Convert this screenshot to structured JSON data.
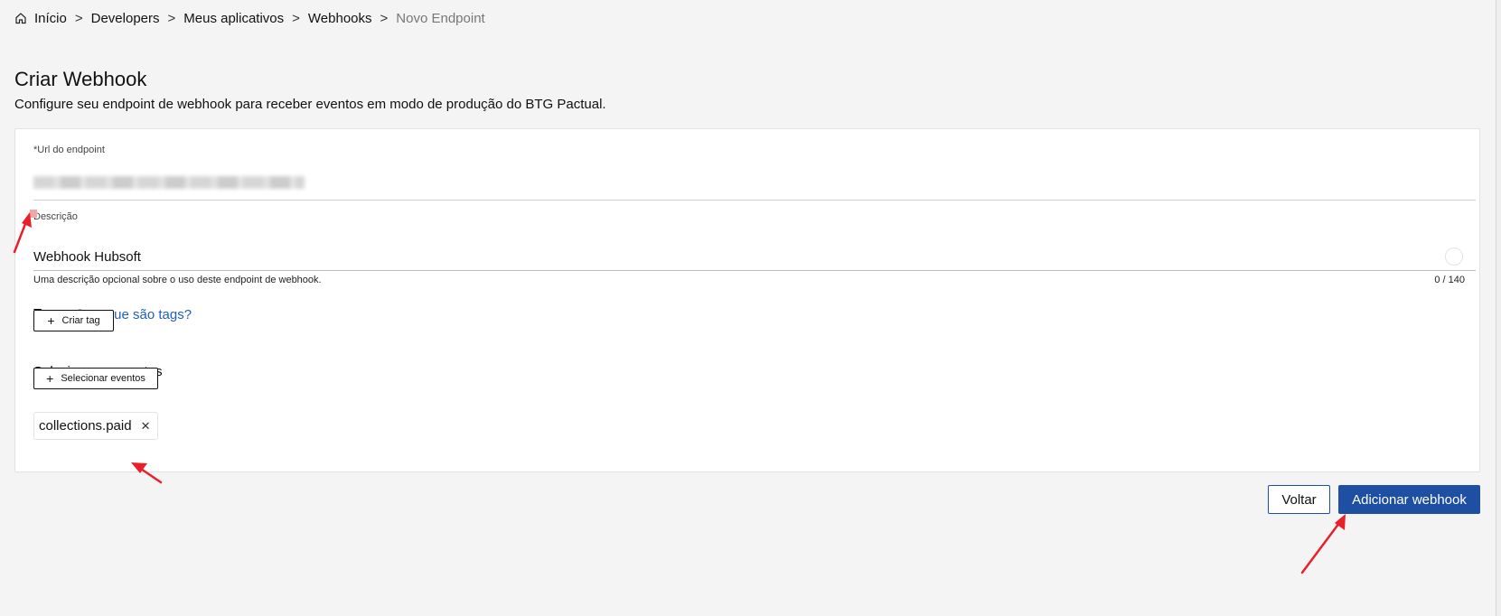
{
  "breadcrumb": {
    "items": [
      "Início",
      "Developers",
      "Meus aplicativos",
      "Webhooks"
    ],
    "current": "Novo Endpoint",
    "separator": ">"
  },
  "header": {
    "title": "Criar Webhook",
    "subtitle": "Configure seu endpoint de webhook para receber eventos em modo de produção do BTG Pactual."
  },
  "form": {
    "url_label": "*Url do endpoint",
    "description_label": "Descrição",
    "description_value": "Webhook Hubsoft",
    "description_help": "Uma descrição opcional sobre o uso deste endpoint de webhook.",
    "description_count": "0 / 140",
    "tags_label": "Tags",
    "tags_help_link": "O que são tags?",
    "create_tag_button": "Criar tag",
    "events_label": "Selecione os eventos",
    "select_events_button": "Selecionar eventos",
    "selected_events": [
      "collections.paid"
    ]
  },
  "actions": {
    "back_label": "Voltar",
    "submit_label": "Adicionar webhook"
  },
  "colors": {
    "primary": "#1e4fa3",
    "link": "#1f5fbf",
    "annotation_arrow": "#e8202a",
    "background": "#f4f4f4"
  },
  "icons": {
    "home": "home-icon",
    "info": "info-icon",
    "plus": "plus-icon",
    "close": "close-icon"
  }
}
